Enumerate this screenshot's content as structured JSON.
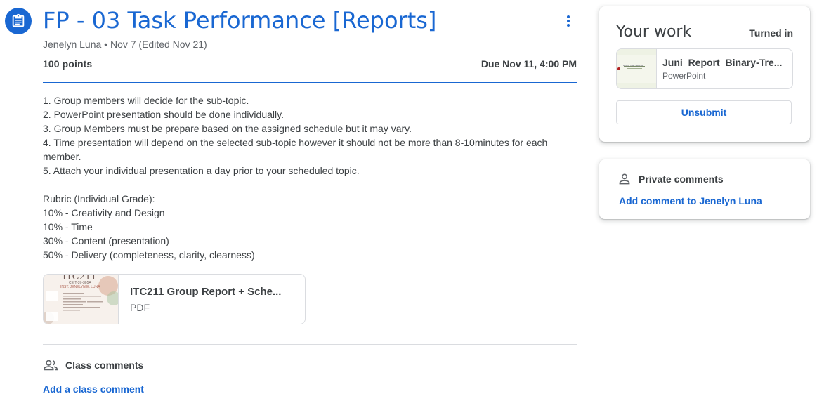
{
  "assignment": {
    "icon": "assignment-icon",
    "title": "FP - 03 Task Performance [Reports]",
    "meta": "Jenelyn Luna • Nov 7 (Edited Nov 21)",
    "points": "100 points",
    "due": "Due Nov 11, 4:00 PM",
    "instructions": "1. Group members will decide for the sub-topic.\n2. PowerPoint presentation should be done individually.\n3. Group Members must be prepare based on the assigned schedule but it may vary.\n4. Time presentation will depend on the selected sub-topic however it should not be more than 8-10minutes for each member.\n5. Attach your individual presentation a day prior to your scheduled topic.\n\nRubric (Individual Grade):\n10% - Creativity and Design\n10% - Time\n30% - Content (presentation)\n50% - Delivery (completeness, clarity, clearness)",
    "attachment": {
      "name": "ITC211 Group Report + Sche...",
      "type": "PDF",
      "thumb_heading": "ITC211",
      "thumb_sub": "CEIT-37-305A",
      "thumb_sub2": "INST. JENELYN E. LUNA"
    }
  },
  "class_comments": {
    "icon": "people-icon",
    "label": "Class comments",
    "add_label": "Add a class comment"
  },
  "your_work": {
    "title": "Your work",
    "status": "Turned in",
    "file": {
      "name": "Juni_Report_Binary-Tre...",
      "type": "PowerPoint",
      "thumb_text": "Binary Tree Traversal"
    },
    "unsubmit_label": "Unsubmit"
  },
  "private_comments": {
    "icon": "person-icon",
    "label": "Private comments",
    "add_label": "Add comment to Jenelyn Luna"
  },
  "colors": {
    "accent": "#1967d2",
    "text": "#3c4043",
    "muted": "#5f6368",
    "border": "#dadce0"
  }
}
